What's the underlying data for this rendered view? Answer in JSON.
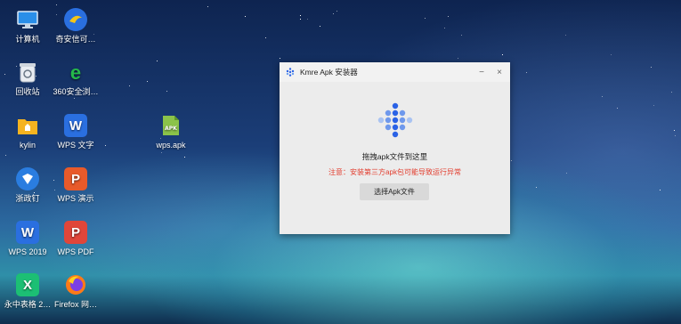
{
  "desktop": {
    "icons": [
      {
        "label": "计算机",
        "icon": "computer-icon"
      },
      {
        "label": "奇安信可…",
        "icon": "qianxin-icon"
      },
      {
        "label": "回收站",
        "icon": "recycle-bin-icon"
      },
      {
        "label": "360安全浏…",
        "icon": "browser-360-icon"
      },
      {
        "label": "kylin",
        "icon": "folder-icon"
      },
      {
        "label": "WPS 文字",
        "icon": "wps-writer-icon"
      },
      {
        "label": "wps.apk",
        "icon": "apk-file-icon"
      },
      {
        "label": "浙政钉",
        "icon": "zhezhengding-icon"
      },
      {
        "label": "WPS 演示",
        "icon": "wps-presentation-icon"
      },
      {
        "label": "WPS 2019",
        "icon": "wps-2019-icon"
      },
      {
        "label": "WPS PDF",
        "icon": "wps-pdf-icon"
      },
      {
        "label": "永中表格 2…",
        "icon": "yozo-sheet-icon"
      },
      {
        "label": "Firefox 网…",
        "icon": "firefox-icon"
      }
    ]
  },
  "dialog": {
    "title": "Kmre Apk 安装器",
    "drag_text": "拖拽apk文件到这里",
    "warning": "注意：安装第三方apk包可能导致运行异常",
    "select_button": "选择Apk文件",
    "minimize": "−",
    "close": "×",
    "colors": {
      "warning": "#e23b2c",
      "accent": "#2a62e6"
    }
  }
}
